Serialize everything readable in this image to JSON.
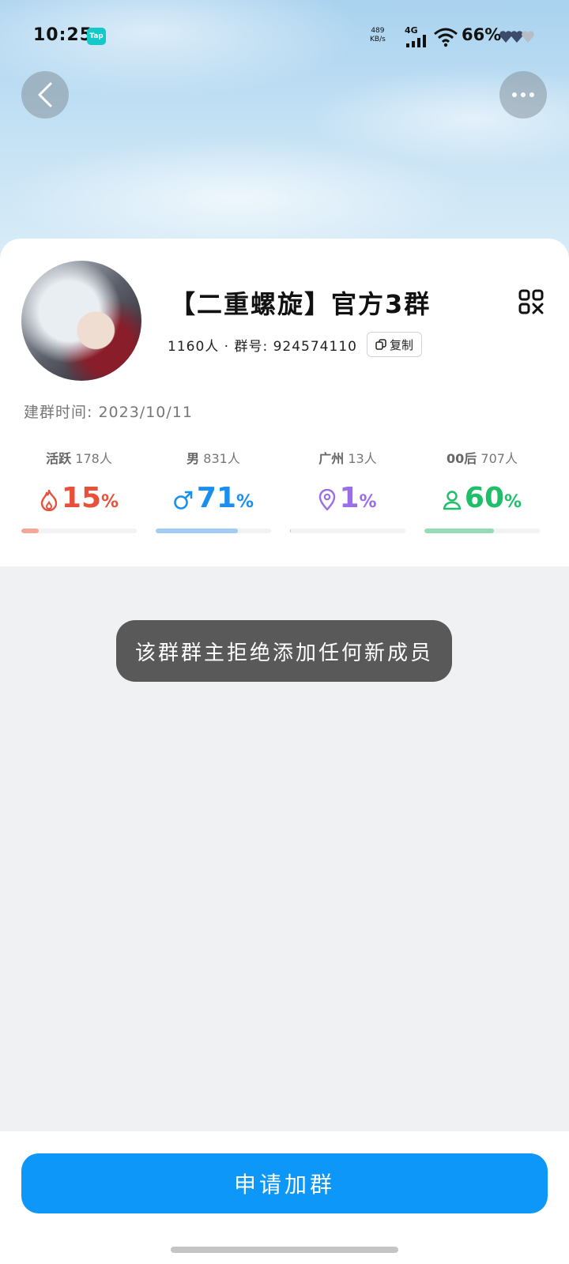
{
  "status_bar": {
    "time": "10:25",
    "tap_badge": "Tap",
    "net_speed_value": "489",
    "net_speed_unit": "KB/s",
    "network_type": "4G",
    "battery": "66%"
  },
  "header": {
    "back_icon": "chevron-left-icon",
    "more_icon": "more-dots-icon"
  },
  "group": {
    "name": "【二重螺旋】官方3群",
    "members_and_id": "1160人 · 群号: 924574110",
    "copy_label": "复制",
    "created_label": "建群时间:",
    "created_date": "2023/10/11"
  },
  "stats": [
    {
      "label": "活跃",
      "count": "178人",
      "value": "15",
      "pct": "%",
      "fraction": 0.15,
      "icon": "flame-icon",
      "color": "#e8503a",
      "bar_color": "#f4a79a"
    },
    {
      "label": "男",
      "count": "831人",
      "value": "71",
      "pct": "%",
      "fraction": 0.71,
      "icon": "male-icon",
      "color": "#1a8ff0",
      "bar_color": "#9fcbf4"
    },
    {
      "label": "广州",
      "count": "13人",
      "value": "1",
      "pct": "%",
      "fraction": 0.01,
      "icon": "location-pin-icon",
      "color": "#9a6ee6",
      "bar_color": "#c8b2f2"
    },
    {
      "label": "00后",
      "count": "707人",
      "value": "60",
      "pct": "%",
      "fraction": 0.6,
      "icon": "person-icon",
      "color": "#1fbf6a",
      "bar_color": "#94dbb6"
    }
  ],
  "toast": {
    "message": "该群群主拒绝添加任何新成员"
  },
  "footer": {
    "join_button": "申请加群"
  }
}
